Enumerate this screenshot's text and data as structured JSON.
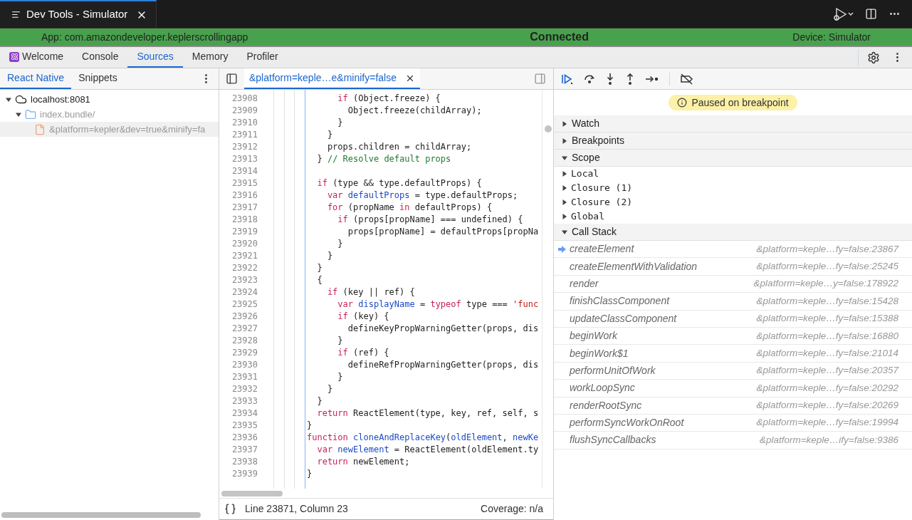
{
  "window_tab": {
    "title": "Dev Tools - Simulator"
  },
  "connection_bar": {
    "app": "App: com.amazondeveloper.keplerscrollingapp",
    "status": "Connected",
    "device": "Device: Simulator"
  },
  "panel_tabs": [
    {
      "label": "Welcome",
      "selected": false
    },
    {
      "label": "Console",
      "selected": false
    },
    {
      "label": "Sources",
      "selected": true
    },
    {
      "label": "Memory",
      "selected": false
    },
    {
      "label": "Profiler",
      "selected": false
    }
  ],
  "navigator": {
    "tabs": [
      {
        "label": "React Native",
        "selected": true
      },
      {
        "label": "Snippets",
        "selected": false
      }
    ],
    "tree": [
      {
        "label": "localhost:8081",
        "kind": "origin",
        "expanded": true,
        "children": [
          {
            "label": "index.bundle/",
            "kind": "folder",
            "expanded": true,
            "children": [
              {
                "label": "&platform=kepler&dev=true&minify=fa",
                "kind": "file",
                "selected": true
              }
            ]
          }
        ]
      }
    ]
  },
  "editor": {
    "tab": {
      "label": "&platform=keple…e&minify=false",
      "selected": true
    },
    "lines": [
      {
        "number": "23908",
        "tokens": [
          {
            "kind": "keyword",
            "text": "      if"
          },
          {
            "kind": "plain",
            "text": " (Object.freeze) {"
          }
        ]
      },
      {
        "number": "23909",
        "tokens": [
          {
            "kind": "plain",
            "text": "        Object.freeze(childArray);"
          }
        ]
      },
      {
        "number": "23910",
        "tokens": [
          {
            "kind": "plain",
            "text": "      }"
          }
        ]
      },
      {
        "number": "23911",
        "tokens": [
          {
            "kind": "plain",
            "text": "    }"
          }
        ]
      },
      {
        "number": "23912",
        "tokens": [
          {
            "kind": "plain",
            "text": "    props.children = childArray;"
          }
        ]
      },
      {
        "number": "23913",
        "tokens": [
          {
            "kind": "plain",
            "text": "  } "
          },
          {
            "kind": "comment",
            "text": "// Resolve default props"
          }
        ]
      },
      {
        "number": "23914"
      },
      {
        "number": "23915",
        "tokens": [
          {
            "kind": "keyword",
            "text": "  if"
          },
          {
            "kind": "plain",
            "text": " (type && type.defaultProps) {"
          }
        ]
      },
      {
        "number": "23916",
        "tokens": [
          {
            "kind": "keyword",
            "text": "    var "
          },
          {
            "kind": "definition",
            "text": "defaultProps"
          },
          {
            "kind": "plain",
            "text": " = type.defaultProps;"
          }
        ]
      },
      {
        "number": "23917",
        "tokens": [
          {
            "kind": "keyword",
            "text": "    for"
          },
          {
            "kind": "plain",
            "text": " (propName "
          },
          {
            "kind": "keyword",
            "text": "in"
          },
          {
            "kind": "plain",
            "text": " defaultProps) {"
          }
        ]
      },
      {
        "number": "23918",
        "tokens": [
          {
            "kind": "keyword",
            "text": "      if"
          },
          {
            "kind": "plain",
            "text": " (props[propName] === undefined) {"
          }
        ]
      },
      {
        "number": "23919",
        "tokens": [
          {
            "kind": "plain",
            "text": "        props[propName] = defaultProps[propNa"
          }
        ]
      },
      {
        "number": "23920",
        "tokens": [
          {
            "kind": "plain",
            "text": "      }"
          }
        ]
      },
      {
        "number": "23921",
        "tokens": [
          {
            "kind": "plain",
            "text": "    }"
          }
        ]
      },
      {
        "number": "23922",
        "tokens": [
          {
            "kind": "plain",
            "text": "  }"
          }
        ]
      },
      {
        "number": "23923",
        "tokens": [
          {
            "kind": "plain",
            "text": "  {"
          }
        ]
      },
      {
        "number": "23924",
        "tokens": [
          {
            "kind": "keyword",
            "text": "    if"
          },
          {
            "kind": "plain",
            "text": " (key || ref) {"
          }
        ]
      },
      {
        "number": "23925",
        "tokens": [
          {
            "kind": "keyword",
            "text": "      var "
          },
          {
            "kind": "definition",
            "text": "displayName"
          },
          {
            "kind": "plain",
            "text": " = "
          },
          {
            "kind": "keyword",
            "text": "typeof"
          },
          {
            "kind": "plain",
            "text": " type === "
          },
          {
            "kind": "string",
            "text": "'func"
          }
        ]
      },
      {
        "number": "23926",
        "tokens": [
          {
            "kind": "keyword",
            "text": "      if"
          },
          {
            "kind": "plain",
            "text": " (key) {"
          }
        ]
      },
      {
        "number": "23927",
        "tokens": [
          {
            "kind": "plain",
            "text": "        defineKeyPropWarningGetter(props, dis"
          }
        ]
      },
      {
        "number": "23928",
        "tokens": [
          {
            "kind": "plain",
            "text": "      }"
          }
        ]
      },
      {
        "number": "23929",
        "tokens": [
          {
            "kind": "keyword",
            "text": "      if"
          },
          {
            "kind": "plain",
            "text": " (ref) {"
          }
        ]
      },
      {
        "number": "23930",
        "tokens": [
          {
            "kind": "plain",
            "text": "        defineRefPropWarningGetter(props, dis"
          }
        ]
      },
      {
        "number": "23931",
        "tokens": [
          {
            "kind": "plain",
            "text": "      }"
          }
        ]
      },
      {
        "number": "23932",
        "tokens": [
          {
            "kind": "plain",
            "text": "    }"
          }
        ]
      },
      {
        "number": "23933",
        "tokens": [
          {
            "kind": "plain",
            "text": "  }"
          }
        ]
      },
      {
        "number": "23934",
        "tokens": [
          {
            "kind": "keyword",
            "text": "  return"
          },
          {
            "kind": "plain",
            "text": " ReactElement(type, key, ref, self, s"
          }
        ]
      },
      {
        "number": "23935",
        "tokens": [
          {
            "kind": "plain",
            "text": "}"
          }
        ]
      },
      {
        "number": "23936",
        "tokens": [
          {
            "kind": "keyword",
            "text": "function "
          },
          {
            "kind": "definition",
            "text": "cloneAndReplaceKey"
          },
          {
            "kind": "plain",
            "text": "("
          },
          {
            "kind": "definition",
            "text": "oldElement"
          },
          {
            "kind": "plain",
            "text": ", "
          },
          {
            "kind": "definition",
            "text": "newKe"
          }
        ]
      },
      {
        "number": "23937",
        "tokens": [
          {
            "kind": "keyword",
            "text": "  var "
          },
          {
            "kind": "definition",
            "text": "newElement"
          },
          {
            "kind": "plain",
            "text": " = ReactElement(oldElement.ty"
          }
        ]
      },
      {
        "number": "23938",
        "tokens": [
          {
            "kind": "keyword",
            "text": "  return"
          },
          {
            "kind": "plain",
            "text": " newElement;"
          }
        ]
      },
      {
        "number": "23939",
        "tokens": [
          {
            "kind": "plain",
            "text": "}"
          }
        ]
      }
    ],
    "status": {
      "position": "Line 23871, Column 23",
      "coverage": "Coverage: n/a"
    }
  },
  "debugger": {
    "paused_message": "Paused on breakpoint",
    "sections": [
      {
        "label": "Watch",
        "expanded": false
      },
      {
        "label": "Breakpoints",
        "expanded": false
      },
      {
        "label": "Scope",
        "expanded": true,
        "children": [
          {
            "label": "Local",
            "expanded": false
          },
          {
            "label": "Closure (1)",
            "expanded": false
          },
          {
            "label": "Closure (2)",
            "expanded": false
          },
          {
            "label": "Global",
            "expanded": false
          }
        ]
      },
      {
        "label": "Call Stack",
        "expanded": true,
        "frames": [
          {
            "function": "createElement",
            "location": "&platform=keple…fy=false:23867",
            "current": true
          },
          {
            "function": "createElementWithValidation",
            "location": "&platform=keple…fy=false:25245",
            "current": false
          },
          {
            "function": "render",
            "location": "&platform=keple…y=false:178922",
            "current": false
          },
          {
            "function": "finishClassComponent",
            "location": "&platform=keple…fy=false:15428",
            "current": false
          },
          {
            "function": "updateClassComponent",
            "location": "&platform=keple…fy=false:15388",
            "current": false
          },
          {
            "function": "beginWork",
            "location": "&platform=keple…fy=false:16880",
            "current": false
          },
          {
            "function": "beginWork$1",
            "location": "&platform=keple…fy=false:21014",
            "current": false
          },
          {
            "function": "performUnitOfWork",
            "location": "&platform=keple…fy=false:20357",
            "current": false
          },
          {
            "function": "workLoopSync",
            "location": "&platform=keple…fy=false:20292",
            "current": false
          },
          {
            "function": "renderRootSync",
            "location": "&platform=keple…fy=false:20269",
            "current": false
          },
          {
            "function": "performSyncWorkOnRoot",
            "location": "&platform=keple…fy=false:19994",
            "current": false
          },
          {
            "function": "flushSyncCallbacks",
            "location": "&platform=keple…ify=false:9386",
            "current": false
          }
        ]
      }
    ]
  }
}
